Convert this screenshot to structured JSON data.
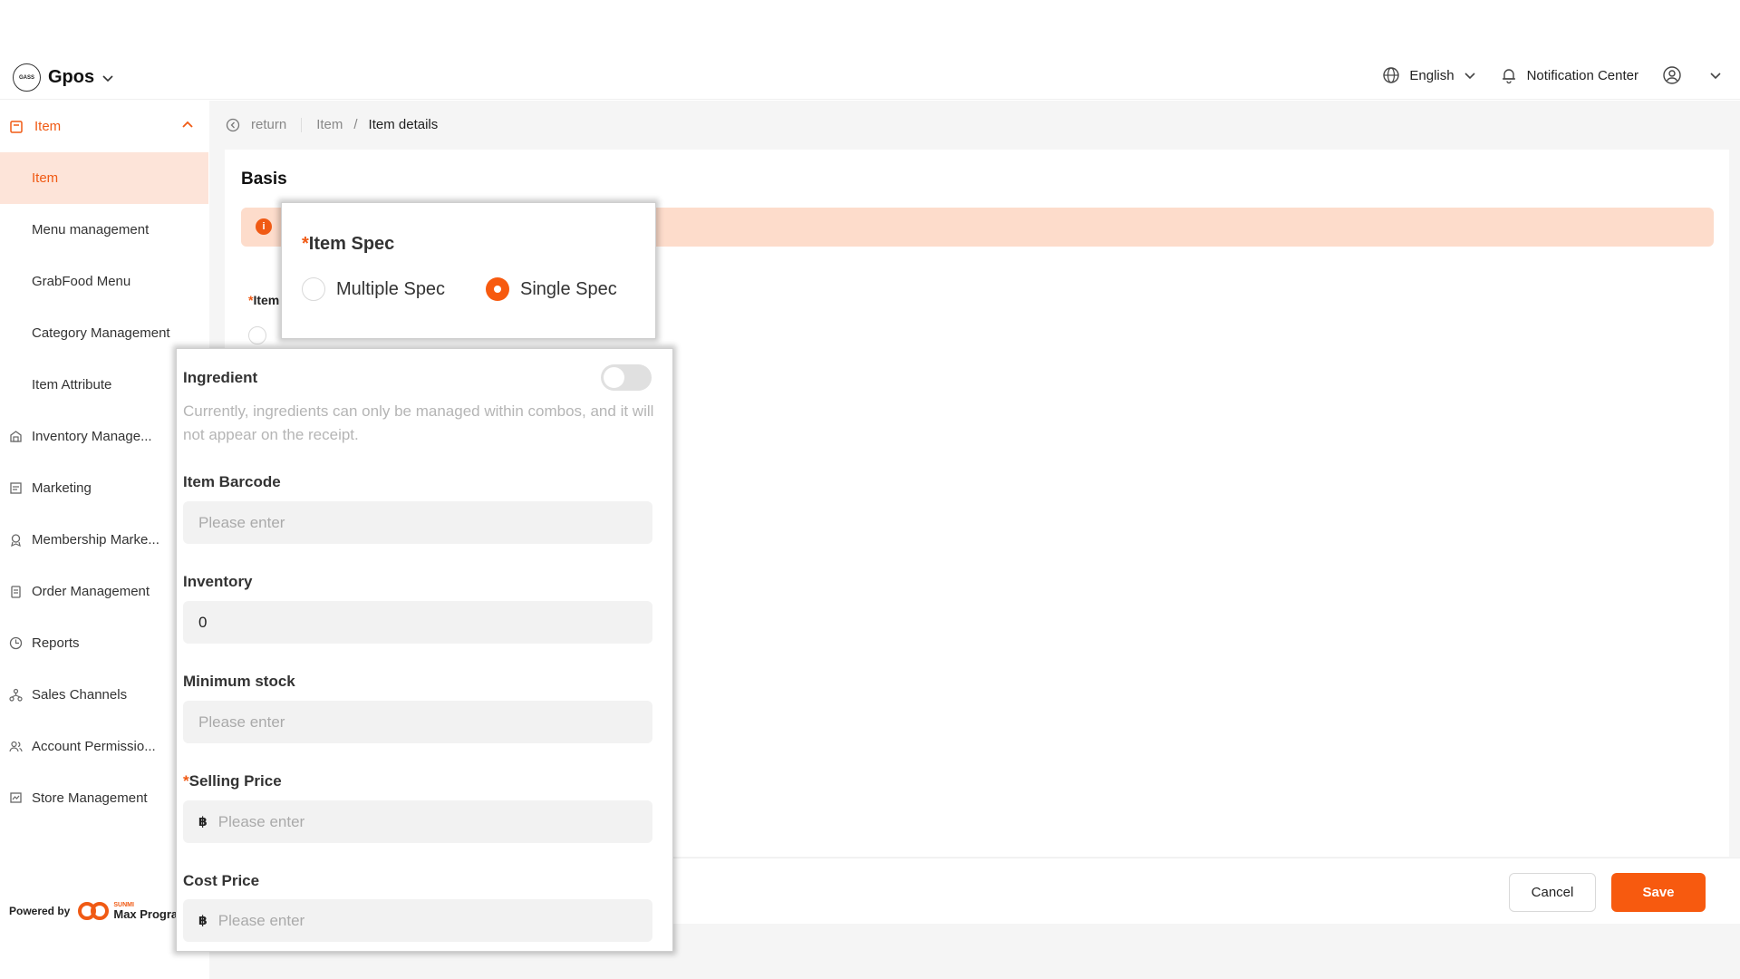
{
  "header": {
    "brand_logo_text": "GASS",
    "brand": "Gpos",
    "language": "English",
    "notification": "Notification Center"
  },
  "sidebar": {
    "parent": "Item",
    "sub_items": [
      "Item",
      "Menu management",
      "GrabFood Menu",
      "Category Management",
      "Item Attribute"
    ],
    "items": [
      "Inventory Manage...",
      "Marketing",
      "Membership Marke...",
      "Order Management",
      "Reports",
      "Sales Channels",
      "Account Permissio...",
      "Store Management"
    ],
    "powered_by": "Powered by",
    "powered_brand": "Max Progra",
    "powered_brand_small": "SUNMI"
  },
  "breadcrumb": {
    "return": "return",
    "parent": "Item",
    "separator": "/",
    "current": "Item details"
  },
  "card": {
    "title": "Basis",
    "alert_icon": "i",
    "bg_label_star": "*",
    "bg_label": "Item"
  },
  "spec": {
    "required": "*",
    "title": "Item Spec",
    "options": [
      "Multiple Spec",
      "Single Spec"
    ],
    "selected": "Single Spec"
  },
  "detail": {
    "ingredient_label": "Ingredient",
    "ingredient_enabled": false,
    "ingredient_hint": "Currently, ingredients can only be managed within combos, and it will not appear on the receipt.",
    "barcode_label": "Item Barcode",
    "barcode_placeholder": "Please enter",
    "inventory_label": "Inventory",
    "inventory_value": "0",
    "min_stock_label": "Minimum stock",
    "min_stock_placeholder": "Please enter",
    "selling_required": "*",
    "selling_label": "Selling Price",
    "selling_currency": "฿",
    "selling_placeholder": "Please enter",
    "cost_label": "Cost Price",
    "cost_currency": "฿",
    "cost_placeholder": "Please enter"
  },
  "footer": {
    "cancel": "Cancel",
    "save": "Save"
  },
  "colors": {
    "accent": "#f75a0f",
    "active_bg": "#fde4d9",
    "alert_bg": "#fddccb"
  }
}
